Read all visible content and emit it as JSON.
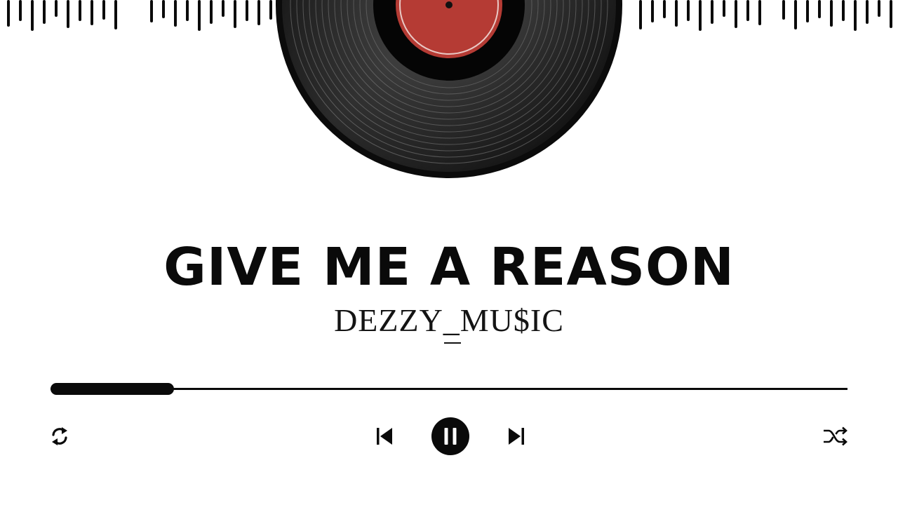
{
  "track": {
    "title": "GIVE ME A REASON",
    "artist": "DEZZY_MU$IC"
  },
  "playback": {
    "progress_fraction": 0.155,
    "state": "playing"
  },
  "controls": {
    "repeat_icon": "repeat-icon",
    "previous_icon": "skip-previous-icon",
    "pause_icon": "pause-icon",
    "next_icon": "skip-next-icon",
    "shuffle_icon": "shuffle-icon"
  },
  "colors": {
    "foreground": "#0a0a0a",
    "background": "#ffffff",
    "vinyl_label": "#b53b34"
  }
}
